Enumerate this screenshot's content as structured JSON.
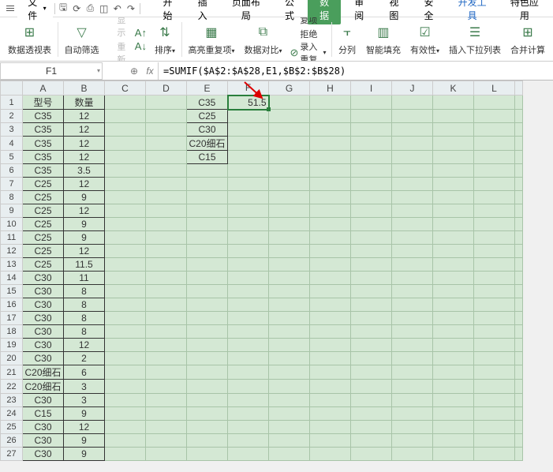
{
  "titlebar": {
    "file_label": "文件",
    "tabs": [
      "开始",
      "插入",
      "页面布局",
      "公式",
      "数据",
      "审阅",
      "视图",
      "安全",
      "开发工具",
      "特色应用"
    ],
    "active_tab_index": 4
  },
  "ribbon": {
    "pivot": "数据透视表",
    "autofilter": "自动筛选",
    "showall": "全部显示",
    "reapply": "重新应用",
    "sort": "排序",
    "hl_dup": "高亮重复项",
    "cmp": "数据对比",
    "remove_dup": "删除重复项",
    "reject_dup": "拒绝录入重复项",
    "split": "分列",
    "smartfill": "智能填充",
    "validity": "有效性",
    "dropdown": "插入下拉列表",
    "merge": "合并计算",
    "down": "▾"
  },
  "formula_bar": {
    "name_box": "F1",
    "formula": "=SUMIF($A$2:$A$28,E1,$B$2:$B$28)"
  },
  "columns": [
    "A",
    "B",
    "C",
    "D",
    "E",
    "F",
    "G",
    "H",
    "I",
    "J",
    "K",
    "L",
    ""
  ],
  "row_count": 27,
  "data": {
    "A1": "型号",
    "B1": "数量",
    "A": [
      "C35",
      "C35",
      "C35",
      "C35",
      "C35",
      "C25",
      "C25",
      "C25",
      "C25",
      "C25",
      "C25",
      "C25",
      "C30",
      "C30",
      "C30",
      "C30",
      "C30",
      "C30",
      "C30",
      "C20细石",
      "C20细石",
      "C30",
      "C15",
      "C30",
      "C30",
      "C30"
    ],
    "B": [
      "12",
      "12",
      "12",
      "12",
      "3.5",
      "12",
      "9",
      "12",
      "9",
      "9",
      "12",
      "11.5",
      "11",
      "8",
      "8",
      "8",
      "8",
      "12",
      "2",
      "6",
      "3",
      "3",
      "9",
      "12",
      "9",
      "9"
    ],
    "E": [
      "C35",
      "C25",
      "C30",
      "C20细石",
      "C15"
    ],
    "F1": "51.5"
  },
  "chart_data": {
    "type": "table",
    "title": "",
    "columns": [
      "型号",
      "数量"
    ],
    "rows": [
      [
        "C35",
        12
      ],
      [
        "C35",
        12
      ],
      [
        "C35",
        12
      ],
      [
        "C35",
        12
      ],
      [
        "C35",
        3.5
      ],
      [
        "C25",
        12
      ],
      [
        "C25",
        9
      ],
      [
        "C25",
        12
      ],
      [
        "C25",
        9
      ],
      [
        "C25",
        9
      ],
      [
        "C25",
        12
      ],
      [
        "C25",
        11.5
      ],
      [
        "C30",
        11
      ],
      [
        "C30",
        8
      ],
      [
        "C30",
        8
      ],
      [
        "C30",
        8
      ],
      [
        "C30",
        8
      ],
      [
        "C30",
        12
      ],
      [
        "C30",
        2
      ],
      [
        "C20细石",
        6
      ],
      [
        "C20细石",
        3
      ],
      [
        "C30",
        3
      ],
      [
        "C15",
        9
      ],
      [
        "C30",
        12
      ],
      [
        "C30",
        9
      ],
      [
        "C30",
        9
      ]
    ],
    "sumif_result": {
      "lookup": "C35",
      "sum": 51.5
    }
  }
}
